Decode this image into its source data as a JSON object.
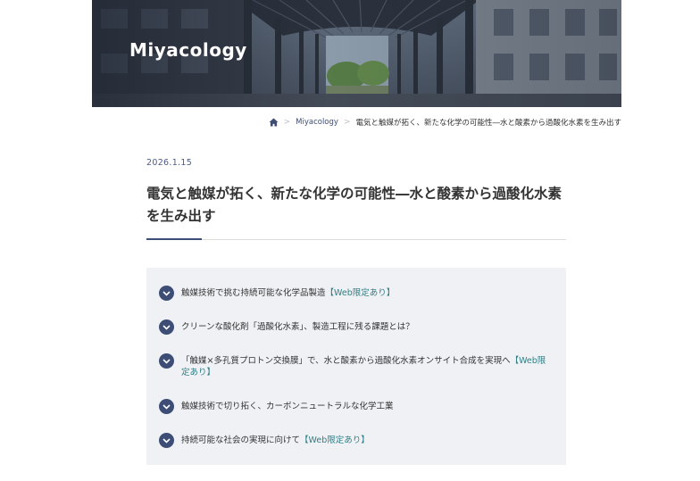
{
  "site": {
    "title": "Miyacology"
  },
  "breadcrumb": {
    "home_icon": "home-icon",
    "separator": ">",
    "items": [
      {
        "label": "Miyacology"
      },
      {
        "label": "電気と触媒が拓く、新たな化学の可能性―水と酸素から過酸化水素を生み出す"
      }
    ]
  },
  "article": {
    "date": "2026.1.15",
    "title_line1": "電気と触媒が拓く、新たな化学の可能性―水と酸素から過酸化水素",
    "title_line2": "を生み出す"
  },
  "toc": {
    "item_icon": "chevron-down-icon",
    "items": [
      {
        "text": "触媒技術で挑む持続可能な化学品製造",
        "tag": "【Web限定あり】"
      },
      {
        "text": "クリーンな酸化剤「過酸化水素」、製造工程に残る課題とは？",
        "tag": ""
      },
      {
        "text": "「触媒×多孔質プロトン交換膜」で、水と酸素から過酸化水素オンサイト合成を実現へ",
        "tag": "【Web限定あり】"
      },
      {
        "text": "触媒技術で切り拓く、カーボンニュートラルな化学工業",
        "tag": ""
      },
      {
        "text": "持続可能な社会の実現に向けて",
        "tag": "【Web限定あり】"
      }
    ]
  },
  "colors": {
    "accent": "#3d4d75",
    "tag": "#2f7f86",
    "toc_bg": "#eff1f4"
  }
}
